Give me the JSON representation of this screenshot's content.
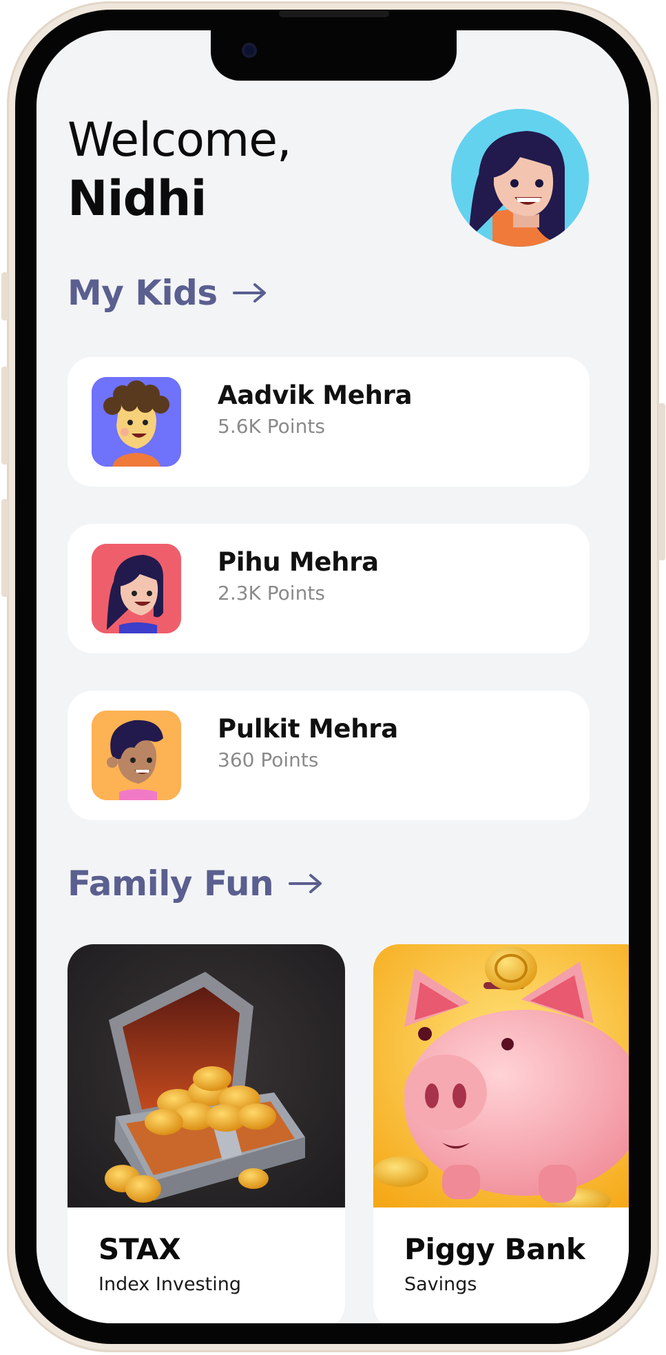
{
  "welcome": {
    "greeting": "Welcome,",
    "name": "Nidhi"
  },
  "sections": {
    "kids_title": "My Kids",
    "fun_title": "Family Fun"
  },
  "kids": [
    {
      "name": "Aadvik Mehra",
      "points": "5.6K Points",
      "bg": "#6f72fb"
    },
    {
      "name": "Pihu Mehra",
      "points": "2.3K Points",
      "bg": "#ee5f6b"
    },
    {
      "name": "Pulkit Mehra",
      "points": "360 Points",
      "bg": "#fdb254"
    }
  ],
  "fun": [
    {
      "title": "STAX",
      "subtitle": "Index Investing"
    },
    {
      "title": "Piggy Bank",
      "subtitle": "Savings"
    }
  ],
  "icons": {
    "section_arrow": "arrow-right-icon",
    "stax_image": "treasure-chest",
    "piggy_image": "piggy-bank"
  },
  "colors": {
    "section_title": "#5a5f8f",
    "screen_bg": "#f3f4f6",
    "card_bg": "#ffffff",
    "avatar_bg": "#63d2ef"
  }
}
